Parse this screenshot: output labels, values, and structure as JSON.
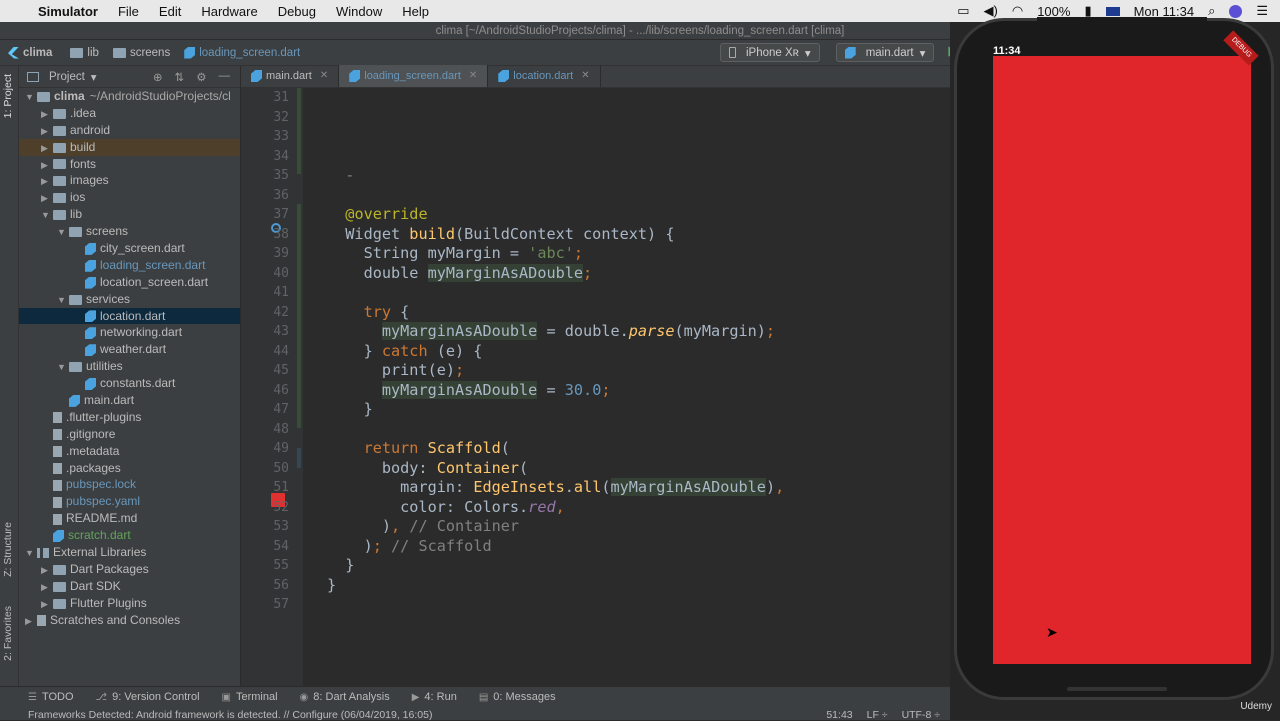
{
  "menubar": {
    "app": "Simulator",
    "items": [
      "File",
      "Edit",
      "Hardware",
      "Debug",
      "Window",
      "Help"
    ],
    "battery": "100%",
    "time": "Mon 11:34"
  },
  "window_title": "clima [~/AndroidStudioProjects/clima] - .../lib/screens/loading_screen.dart [clima]",
  "nav": {
    "crumbs": [
      "clima",
      "lib",
      "screens",
      "loading_screen.dart"
    ],
    "device": "iPhone Xʀ",
    "config": "main.dart"
  },
  "left_tabs": {
    "project": "1: Project",
    "structure": "Z: Structure",
    "favorites": "2: Favorites"
  },
  "project": {
    "title": "Project",
    "tree": [
      {
        "t": "clima",
        "sub": "~/AndroidStudioProjects/cl",
        "d": 0,
        "a": "▼",
        "k": "folder"
      },
      {
        "t": ".idea",
        "d": 1,
        "a": "▶",
        "k": "folder"
      },
      {
        "t": "android",
        "d": 1,
        "a": "▶",
        "k": "folder"
      },
      {
        "t": "build",
        "d": 1,
        "a": "▶",
        "k": "folder",
        "hl": true
      },
      {
        "t": "fonts",
        "d": 1,
        "a": "▶",
        "k": "folder"
      },
      {
        "t": "images",
        "d": 1,
        "a": "▶",
        "k": "folder"
      },
      {
        "t": "ios",
        "d": 1,
        "a": "▶",
        "k": "folder"
      },
      {
        "t": "lib",
        "d": 1,
        "a": "▼",
        "k": "folder"
      },
      {
        "t": "screens",
        "d": 2,
        "a": "▼",
        "k": "folder"
      },
      {
        "t": "city_screen.dart",
        "d": 3,
        "a": "",
        "k": "dart"
      },
      {
        "t": "loading_screen.dart",
        "d": 3,
        "a": "",
        "k": "dart",
        "c": "blue"
      },
      {
        "t": "location_screen.dart",
        "d": 3,
        "a": "",
        "k": "dart"
      },
      {
        "t": "services",
        "d": 2,
        "a": "▼",
        "k": "folder"
      },
      {
        "t": "location.dart",
        "d": 3,
        "a": "",
        "k": "dart",
        "sel": true
      },
      {
        "t": "networking.dart",
        "d": 3,
        "a": "",
        "k": "dart"
      },
      {
        "t": "weather.dart",
        "d": 3,
        "a": "",
        "k": "dart"
      },
      {
        "t": "utilities",
        "d": 2,
        "a": "▼",
        "k": "folder"
      },
      {
        "t": "constants.dart",
        "d": 3,
        "a": "",
        "k": "dart"
      },
      {
        "t": "main.dart",
        "d": 2,
        "a": "",
        "k": "dart"
      },
      {
        "t": ".flutter-plugins",
        "d": 1,
        "a": "",
        "k": "file"
      },
      {
        "t": ".gitignore",
        "d": 1,
        "a": "",
        "k": "file"
      },
      {
        "t": ".metadata",
        "d": 1,
        "a": "",
        "k": "file"
      },
      {
        "t": ".packages",
        "d": 1,
        "a": "",
        "k": "file"
      },
      {
        "t": "pubspec.lock",
        "d": 1,
        "a": "",
        "k": "file",
        "c": "blue"
      },
      {
        "t": "pubspec.yaml",
        "d": 1,
        "a": "",
        "k": "file",
        "c": "blue"
      },
      {
        "t": "README.md",
        "d": 1,
        "a": "",
        "k": "file"
      },
      {
        "t": "scratch.dart",
        "d": 1,
        "a": "",
        "k": "dart",
        "c": "green"
      },
      {
        "t": "External Libraries",
        "d": 0,
        "a": "▼",
        "k": "lib"
      },
      {
        "t": "Dart Packages",
        "d": 1,
        "a": "▶",
        "k": "folder"
      },
      {
        "t": "Dart SDK",
        "d": 1,
        "a": "▶",
        "k": "folder"
      },
      {
        "t": "Flutter Plugins",
        "d": 1,
        "a": "▶",
        "k": "folder"
      },
      {
        "t": "Scratches and Consoles",
        "d": 0,
        "a": "▶",
        "k": "file"
      }
    ]
  },
  "tabs": [
    {
      "label": "main.dart",
      "active": false
    },
    {
      "label": "loading_screen.dart",
      "active": true
    },
    {
      "label": "location.dart",
      "active": false
    }
  ],
  "code": [
    {
      "n": "31",
      "h": ""
    },
    {
      "n": "32",
      "h": ""
    },
    {
      "n": "33",
      "h": ""
    },
    {
      "n": "34",
      "h": ""
    },
    {
      "n": "35",
      "h": "  <span class='cm'>-</span>"
    },
    {
      "n": "36",
      "h": ""
    },
    {
      "n": "37",
      "h": "  <span class='ann'>@override</span>"
    },
    {
      "n": "38",
      "h": "  Widget <span class='fn'>build</span>(BuildContext context) {"
    },
    {
      "n": "39",
      "h": "    String myMargin = <span class='str'>'abc'</span><span class='kw'>;</span>"
    },
    {
      "n": "40",
      "h": "    double <span class='hl'>myMarginAsADouble</span><span class='kw'>;</span>"
    },
    {
      "n": "41",
      "h": ""
    },
    {
      "n": "42",
      "h": "    <span class='kw'>try</span> {"
    },
    {
      "n": "43",
      "h": "      <span class='hl'>myMarginAsADouble</span> = double.<span class='fn it'>parse</span>(myMargin)<span class='kw'>;</span>"
    },
    {
      "n": "44",
      "h": "    } <span class='kw'>catch</span> (e) {"
    },
    {
      "n": "45",
      "h": "      print(e)<span class='kw'>;</span>"
    },
    {
      "n": "46",
      "h": "      <span class='hl'>myMarginAsADouble</span> = <span class='num'>30.0</span><span class='kw'>;</span>"
    },
    {
      "n": "47",
      "h": "    }"
    },
    {
      "n": "48",
      "h": ""
    },
    {
      "n": "49",
      "h": "    <span class='kw'>return</span> <span class='fn'>Scaffold</span>("
    },
    {
      "n": "50",
      "h": "      body: <span class='fn'>Container</span>("
    },
    {
      "n": "51",
      "h": "        margin: <span class='fn'>EdgeInsets</span>.<span class='fn'>all</span>(<span class='hl'>myMarginAsADouble</span>)<span class='kw'>,</span>"
    },
    {
      "n": "52",
      "h": "        color: Colors.<span class='red-it'>red</span><span class='kw'>,</span>"
    },
    {
      "n": "53",
      "h": "      )<span class='kw'>,</span> <span class='cm'>// Container</span>"
    },
    {
      "n": "54",
      "h": "    )<span class='kw'>;</span> <span class='cm'>// Scaffold</span>"
    },
    {
      "n": "55",
      "h": "  }"
    },
    {
      "n": "56",
      "h": "}"
    },
    {
      "n": "57",
      "h": ""
    }
  ],
  "toolwindows": [
    "TODO",
    "9: Version Control",
    "Terminal",
    "8: Dart Analysis",
    "4: Run",
    "0: Messages"
  ],
  "status": {
    "message": "Frameworks Detected: Android framework is detected. // Configure (06/04/2019, 16:05)",
    "position": "51:43",
    "lf": "LF ÷",
    "encoding": "UTF-8 ÷"
  },
  "simulator": {
    "time": "11:34",
    "screen_color": "#e1262b",
    "badge": "DEBUG",
    "watermark": "Udemy"
  }
}
